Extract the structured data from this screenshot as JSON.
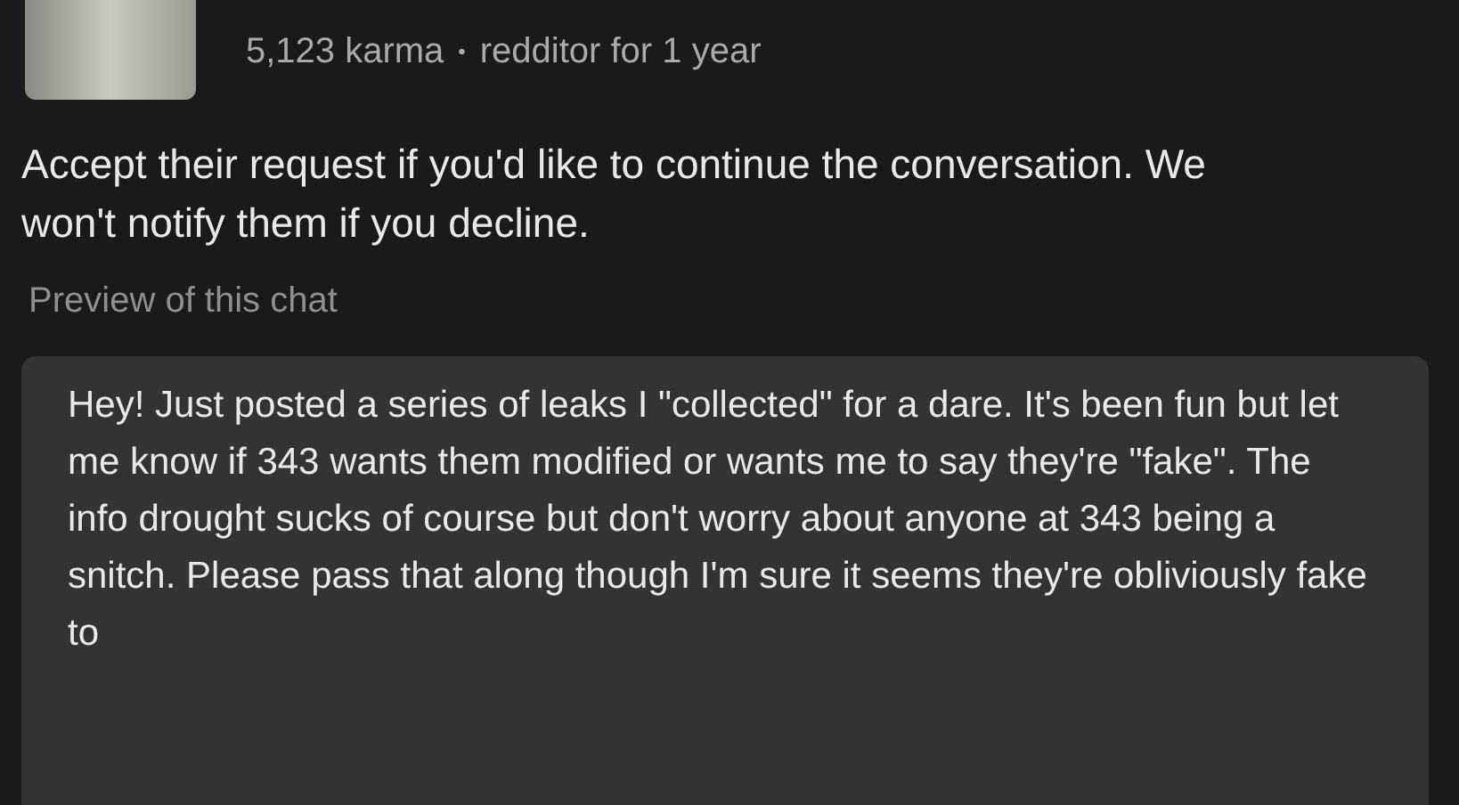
{
  "profile": {
    "karma": "5,123 karma",
    "separator": "•",
    "age": "redditor for 1 year"
  },
  "notice": "Accept their request if you'd like to continue the conversation. We won't notify them if you decline.",
  "preview": {
    "label": "Preview of this chat",
    "message": "Hey! Just posted a series of leaks I \"collected\" for a dare. It's been fun but let me know if 343 wants them modified or wants me to say they're \"fake\". The info drought sucks of course but don't worry about anyone at 343 being a snitch. Please pass that along though I'm sure it seems they're obliviously fake to"
  }
}
